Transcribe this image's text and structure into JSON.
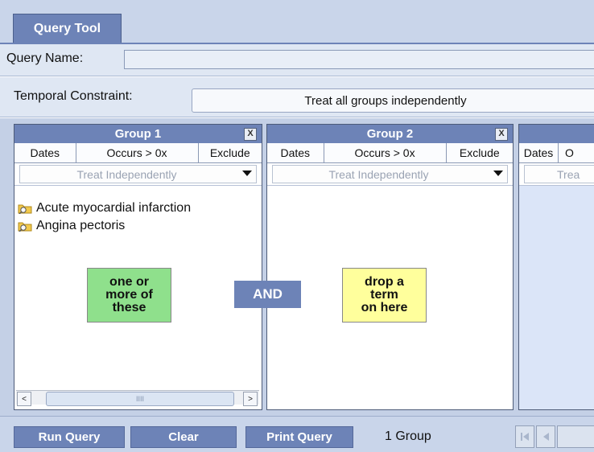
{
  "header": {
    "tab_label": "Query Tool"
  },
  "query_name": {
    "label": "Query Name:",
    "value": ""
  },
  "temporal": {
    "label": "Temporal Constraint:",
    "value": "Treat all groups independently"
  },
  "groups": [
    {
      "title": "Group 1",
      "close": "X",
      "columns": [
        "Dates",
        "Occurs > 0x",
        "Exclude"
      ],
      "timing": "Treat Independently",
      "terms": [
        "Acute myocardial infarction",
        "Angina pectoris"
      ],
      "note": [
        "one or",
        "more of",
        "these"
      ]
    },
    {
      "title": "Group 2",
      "close": "X",
      "columns": [
        "Dates",
        "Occurs > 0x",
        "Exclude"
      ],
      "timing": "Treat Independently",
      "terms": [],
      "note": [
        "drop a",
        "term",
        "on here"
      ]
    },
    {
      "title": "",
      "columns": [
        "Dates",
        "O"
      ],
      "timing": "Trea"
    }
  ],
  "connector": "AND",
  "scrollbar": {
    "left": "<",
    "right": ">",
    "thumb": "IIII"
  },
  "footer": {
    "run": "Run Query",
    "clear": "Clear",
    "print": "Print Query",
    "group_count": "1 Group"
  },
  "colors": {
    "accent": "#6d83b7",
    "green_note": "#8fe08c",
    "yellow_note": "#ffff9c"
  },
  "icons": [
    "folder-icon",
    "close-icon",
    "chevron-down-icon",
    "first-page-icon",
    "previous-page-icon"
  ]
}
